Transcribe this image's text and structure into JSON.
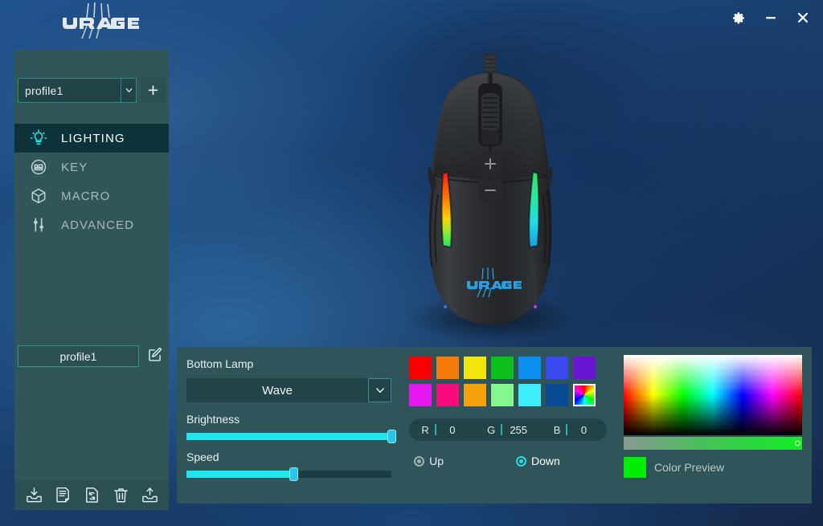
{
  "window": {
    "brand": "uRage",
    "controls": [
      {
        "name": "settings-button",
        "glyph": "gear"
      },
      {
        "name": "minimize-button",
        "glyph": "minimize"
      },
      {
        "name": "close-button",
        "glyph": "close"
      }
    ]
  },
  "sidebar": {
    "profile_select": {
      "value": "profile1",
      "caret": "chevron-down",
      "add_label": "+"
    },
    "nav": [
      {
        "label": "LIGHTING",
        "icon": "lightbulb-icon",
        "active": true
      },
      {
        "label": "KEY",
        "icon": "keypad-icon",
        "active": false
      },
      {
        "label": "MACRO",
        "icon": "cube-icon",
        "active": false
      },
      {
        "label": "ADVANCED",
        "icon": "sliders-icon",
        "active": false
      }
    ],
    "profile_name": "profile1",
    "edit_icon": "pencil-edit-icon",
    "toolbar": [
      {
        "name": "import-profile-button",
        "icon": "import-tray-icon"
      },
      {
        "name": "new-profile-button",
        "icon": "document-icon"
      },
      {
        "name": "reset-profile-button",
        "icon": "refresh-document-icon"
      },
      {
        "name": "delete-profile-button",
        "icon": "trash-icon"
      },
      {
        "name": "export-profile-button",
        "icon": "export-tray-icon"
      }
    ]
  },
  "preview": {
    "device": "gaming-mouse",
    "logo_text": "uRage"
  },
  "lighting": {
    "zone_label": "Bottom Lamp",
    "effect": "Wave",
    "effect_caret": "chevron-down",
    "brightness_label": "Brightness",
    "brightness_value": 100,
    "speed_label": "Speed",
    "speed_value": 52,
    "swatches_row1": [
      "#fa0000",
      "#f57c0a",
      "#f2e60d",
      "#0cc11e",
      "#0d8ff0",
      "#3a48f0",
      "#6a14d4"
    ],
    "swatches_row2": [
      "#e516f0",
      "#fa0a7d",
      "#f7a10a",
      "#86f78c",
      "#3ceefa",
      "#064a93"
    ],
    "swatch_picker": "rainbow-swatch",
    "rgb": {
      "r_label": "R",
      "r_value": "0",
      "g_label": "G",
      "g_value": "255",
      "b_label": "B",
      "b_value": "0"
    },
    "direction": [
      {
        "label": "Up",
        "selected": false
      },
      {
        "label": "Down",
        "selected": true
      }
    ],
    "color_preview_label": "Color Preview",
    "color_preview_hex": "#00ee00"
  }
}
